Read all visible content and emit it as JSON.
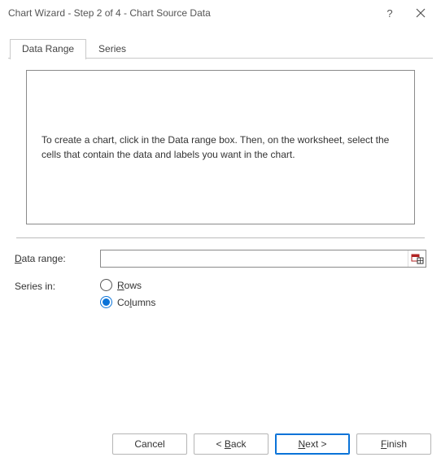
{
  "titlebar": {
    "title": "Chart Wizard - Step 2 of 4 - Chart Source Data",
    "help": "?"
  },
  "tabs": {
    "data_range": "Data Range",
    "series": "Series"
  },
  "preview": {
    "message": "To create a chart, click in the Data range box. Then, on the worksheet, select the cells that contain the data and labels you want in the chart."
  },
  "form": {
    "data_range_label_pre": "D",
    "data_range_label_post": "ata range:",
    "data_range_value": "",
    "series_in_label": "Series in:",
    "rows_pre": "R",
    "rows_post": "ows",
    "columns_pre": "Co",
    "columns_u": "l",
    "columns_post": "umns"
  },
  "buttons": {
    "cancel": "Cancel",
    "back_lt": "< ",
    "back_u": "B",
    "back_rest": "ack",
    "next_u": "N",
    "next_rest": "ext >",
    "finish_u": "F",
    "finish_rest": "inish"
  }
}
